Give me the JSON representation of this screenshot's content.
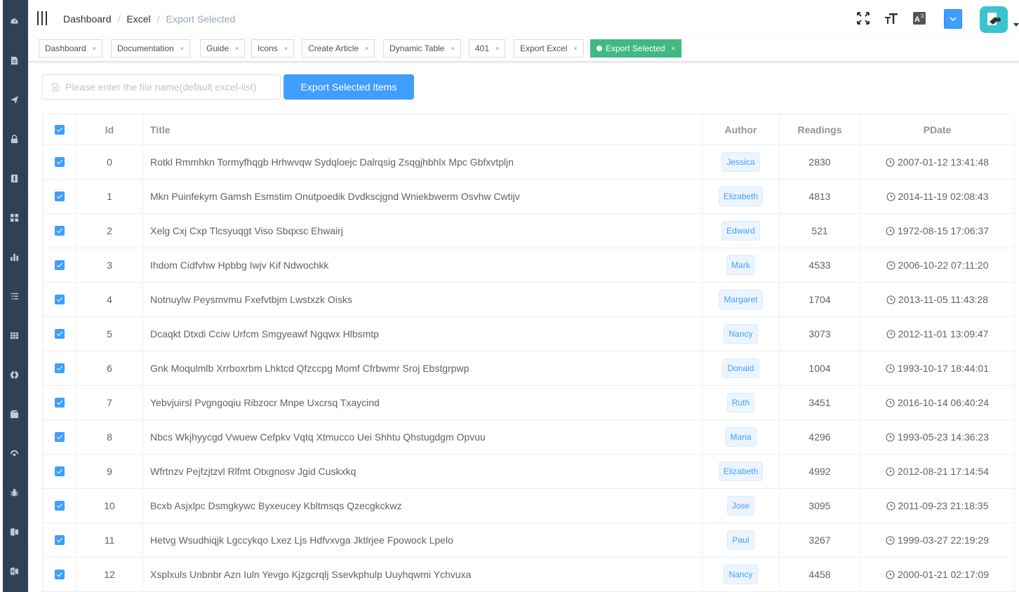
{
  "sidebar": {
    "icons": [
      "dashboard-icon",
      "documentation-icon",
      "guide-icon",
      "permission-lock-icon",
      "icons-icon",
      "components-icon",
      "charts-icon",
      "nested-list-icon",
      "table-icon",
      "example-icon",
      "tab-icon",
      "error-pages-icon",
      "error-log-icon",
      "excel-icon",
      "zip-icon"
    ]
  },
  "breadcrumb": [
    "Dashboard",
    "Excel",
    "Export Selected"
  ],
  "navbar": {
    "icons": [
      "fullscreen-icon",
      "font-size-icon",
      "translate-icon",
      "language-dropdown-icon",
      "user-avatar"
    ]
  },
  "tags": [
    {
      "label": "Dashboard",
      "active": false
    },
    {
      "label": "Documentation",
      "active": false
    },
    {
      "label": "Guide",
      "active": false
    },
    {
      "label": "Icons",
      "active": false
    },
    {
      "label": "Create Article",
      "active": false
    },
    {
      "label": "Dynamic Table",
      "active": false
    },
    {
      "label": "401",
      "active": false
    },
    {
      "label": "Export Excel",
      "active": false
    },
    {
      "label": "Export Selected",
      "active": true
    }
  ],
  "toolbar": {
    "filename_placeholder": "Please enter the file name(default excel-list)",
    "filename_value": "",
    "export_label": "Export Selected Items"
  },
  "table": {
    "columns": [
      "Id",
      "Title",
      "Author",
      "Readings",
      "PDate"
    ],
    "rows": [
      {
        "id": "0",
        "title": "Rotkl Rmmhkn Tormyfhqgb Hrhwvqw Sydqloejc Dalrqsig Zsqgjhbhlx Mpc Gbfxvtpljn",
        "author": "Jessica",
        "readings": "2830",
        "date": "2007-01-12 13:41:48",
        "checked": true
      },
      {
        "id": "1",
        "title": "Mkn Puinfekym Gamsh Esmstim Onutpoedik Dvdkscjgnd Wniekbwerm Osvhw Cwtijv",
        "author": "Elizabeth",
        "readings": "4813",
        "date": "2014-11-19 02:08:43",
        "checked": true
      },
      {
        "id": "2",
        "title": "Xelg Cxj Cxp Tlcsyuqgt Viso Sbqxsc Ehwairj",
        "author": "Edward",
        "readings": "521",
        "date": "1972-08-15 17:06:37",
        "checked": true
      },
      {
        "id": "3",
        "title": "Ihdom Cidfvhw Hpbbg Iwjv Kif Ndwochkk",
        "author": "Mark",
        "readings": "4533",
        "date": "2006-10-22 07:11:20",
        "checked": true
      },
      {
        "id": "4",
        "title": "Notnuylw Peysmvmu Fxefvtbjm Lwstxzk Oisks",
        "author": "Margaret",
        "readings": "1704",
        "date": "2013-11-05 11:43:28",
        "checked": true
      },
      {
        "id": "5",
        "title": "Dcaqkt Dtxdi Cciw Urfcm Smgyeawf Ngqwx Hlbsmtp",
        "author": "Nancy",
        "readings": "3073",
        "date": "2012-11-01 13:09:47",
        "checked": true
      },
      {
        "id": "6",
        "title": "Gnk Moqulmlb Xrrboxrbm Lhktcd Qfzccpg Momf Cfrbwmr Sroj Ebstgrpwp",
        "author": "Donald",
        "readings": "1004",
        "date": "1993-10-17 18:44:01",
        "checked": true
      },
      {
        "id": "7",
        "title": "Yebvjuirsl Pvgngoqiu Ribzocr Mnpe Uxcrsq Txaycind",
        "author": "Ruth",
        "readings": "3451",
        "date": "2016-10-14 06:40:24",
        "checked": true
      },
      {
        "id": "8",
        "title": "Nbcs Wkjhyycgd Vwuew Cefpkv Vqtq Xtmucco Uei Shhtu Qhstugdgm Opvuu",
        "author": "Maria",
        "readings": "4296",
        "date": "1993-05-23 14:36:23",
        "checked": true
      },
      {
        "id": "9",
        "title": "Wfrtnzv Pejfzjtzvl Rlfmt Otxgnosv Jgid Cuskxkq",
        "author": "Elizabeth",
        "readings": "4992",
        "date": "2012-08-21 17:14:54",
        "checked": true
      },
      {
        "id": "10",
        "title": "Bcxb Asjxlpc Dsmgkywc Byxeucey Kbltmsqs Qzecgkckwz",
        "author": "Jose",
        "readings": "3095",
        "date": "2011-09-23 21:18:35",
        "checked": true
      },
      {
        "id": "11",
        "title": "Hetvg Wsudhiqjk Lgccykqo Lxez Ljs Hdfvxvga Jktlrjee Fpowock Lpelo",
        "author": "Paul",
        "readings": "3267",
        "date": "1999-03-27 22:19:29",
        "checked": true
      },
      {
        "id": "12",
        "title": "Xsplxuls Unbnbr Azn Iuln Yevgo Kjzgcrqlj Ssevkphulp Uuyhqwmi Ychvuxa",
        "author": "Nancy",
        "readings": "4458",
        "date": "2000-01-21 02:17:09",
        "checked": true
      }
    ]
  },
  "colors": {
    "sidebar_bg": "#304156",
    "primary": "#409eff",
    "active_tag": "#42b983",
    "avatar_bg": "#3bc4cf"
  }
}
